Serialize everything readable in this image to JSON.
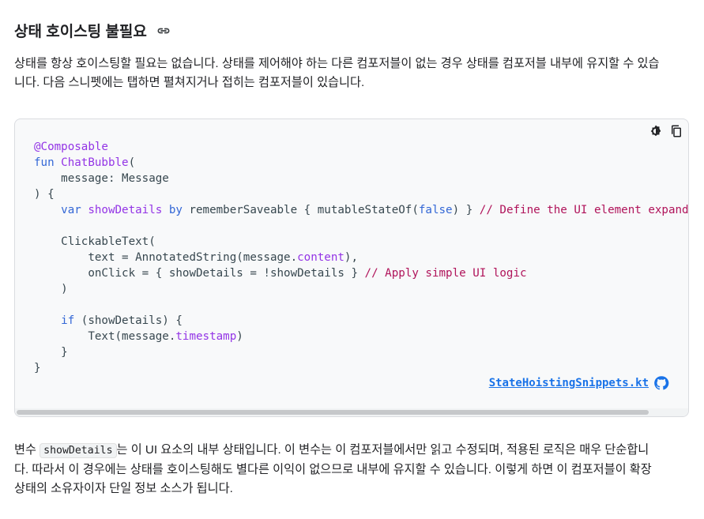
{
  "heading": {
    "title": "상태 호이스팅 불필요",
    "link_icon": "link-icon"
  },
  "intro": {
    "line1": "상태를 항상 호이스팅할 필요는 없습니다. 상태를 제어해야 하는 다른 컴포저블이 없는 경우 상태를 컴포저블 내부에 유지할 수 있습",
    "line2": "니다. 다음 스니펫에는 탭하면 펼쳐지거나 접히는 컴포저블이 있습니다."
  },
  "code": {
    "tools": [
      "theme-toggle-icon",
      "copy-icon"
    ],
    "lines": [
      [
        {
          "t": "@Composable",
          "c": "ann"
        }
      ],
      [
        {
          "t": "fun ",
          "c": "kw"
        },
        {
          "t": "ChatBubble",
          "c": "fn"
        },
        {
          "t": "(",
          "c": ""
        }
      ],
      [
        {
          "t": "    message: Message",
          "c": ""
        }
      ],
      [
        {
          "t": ") {",
          "c": ""
        }
      ],
      [
        {
          "t": "    ",
          "c": ""
        },
        {
          "t": "var ",
          "c": "kw"
        },
        {
          "t": "showDetails ",
          "c": "fn"
        },
        {
          "t": "by ",
          "c": "kw"
        },
        {
          "t": "rememberSaveable { mutableStateOf(",
          "c": ""
        },
        {
          "t": "false",
          "c": "kw"
        },
        {
          "t": ") } ",
          "c": ""
        },
        {
          "t": "// Define the UI element expanded",
          "c": "cm"
        }
      ],
      [
        {
          "t": "",
          "c": ""
        }
      ],
      [
        {
          "t": "    ClickableText(",
          "c": ""
        }
      ],
      [
        {
          "t": "        text = AnnotatedString(message.",
          "c": ""
        },
        {
          "t": "content",
          "c": "prop"
        },
        {
          "t": "),",
          "c": ""
        }
      ],
      [
        {
          "t": "        onClick = { showDetails = !showDetails } ",
          "c": ""
        },
        {
          "t": "// Apply simple UI logic",
          "c": "cm"
        }
      ],
      [
        {
          "t": "    )",
          "c": ""
        }
      ],
      [
        {
          "t": "",
          "c": ""
        }
      ],
      [
        {
          "t": "    ",
          "c": ""
        },
        {
          "t": "if ",
          "c": "kw"
        },
        {
          "t": "(showDetails) {",
          "c": ""
        }
      ],
      [
        {
          "t": "        Text(message.",
          "c": ""
        },
        {
          "t": "timestamp",
          "c": "prop"
        },
        {
          "t": ")",
          "c": ""
        }
      ],
      [
        {
          "t": "    }",
          "c": ""
        }
      ],
      [
        {
          "t": "}",
          "c": ""
        }
      ]
    ],
    "file_link": "StateHoistingSnippets.kt",
    "github_icon": "github-icon"
  },
  "outro": {
    "line1_pre": "변수 ",
    "line1_code": "showDetails",
    "line1_post": "는 이 UI 요소의 내부 상태입니다. 이 변수는 이 컴포저블에서만 읽고 수정되며, 적용된 로직은 매우 단순합니",
    "line2": "다. 따라서 이 경우에는 상태를 호이스팅해도 별다른 이익이 없으므로 내부에 유지할 수 있습니다. 이렇게 하면 이 컴포저블이 확장",
    "line3": "상태의 소유자이자 단일 정보 소스가 됩니다."
  },
  "colors": {
    "keyword": "#3367d6",
    "annotation": "#9334e6",
    "comment": "#b0135a",
    "link": "#1a73e8"
  }
}
